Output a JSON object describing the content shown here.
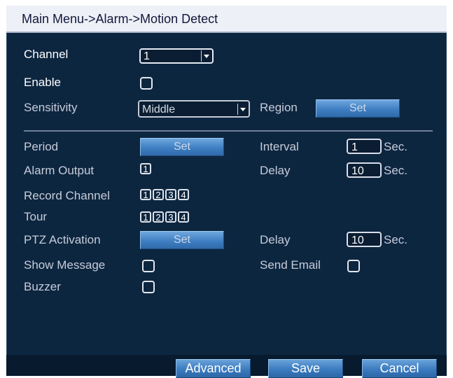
{
  "title": "Main Menu->Alarm->Motion Detect",
  "channel": {
    "label": "Channel",
    "value": "1"
  },
  "enable": {
    "label": "Enable",
    "checked": false
  },
  "sensitivity": {
    "label": "Sensitivity",
    "value": "Middle"
  },
  "region": {
    "label": "Region",
    "button": "Set"
  },
  "period": {
    "label": "Period",
    "button": "Set"
  },
  "interval": {
    "label": "Interval",
    "value": "1",
    "unit": "Sec."
  },
  "alarm_output": {
    "label": "Alarm Output",
    "channels": [
      "1"
    ]
  },
  "delay1": {
    "label": "Delay",
    "value": "10",
    "unit": "Sec."
  },
  "record_channel": {
    "label": "Record Channel",
    "channels": [
      "1",
      "2",
      "3",
      "4"
    ]
  },
  "tour": {
    "label": "Tour",
    "channels": [
      "1",
      "2",
      "3",
      "4"
    ]
  },
  "ptz": {
    "label": "PTZ Activation",
    "button": "Set"
  },
  "delay2": {
    "label": "Delay",
    "value": "10",
    "unit": "Sec."
  },
  "show_message": {
    "label": "Show Message",
    "checked": false
  },
  "send_email": {
    "label": "Send Email",
    "checked": false
  },
  "buzzer": {
    "label": "Buzzer",
    "checked": false
  },
  "footer": {
    "advanced": "Advanced",
    "save": "Save",
    "cancel": "Cancel"
  }
}
